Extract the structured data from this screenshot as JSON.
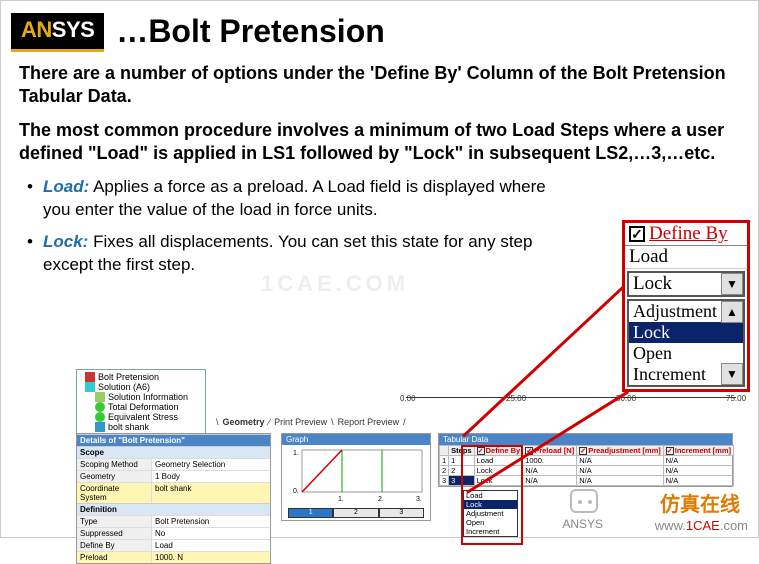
{
  "logo": {
    "prefix": "AN",
    "suffix": "SYS"
  },
  "title": "…Bolt Pretension",
  "para1": "There are a number of options under the 'Define By' Column of the Bolt Pretension Tabular Data.",
  "para2": "The most common procedure involves a minimum of two Load Steps where a user defined \"Load\" is applied in LS1 followed by \"Lock\" in subsequent LS2,…3,…etc.",
  "bullets": [
    {
      "kw": "Load:",
      "text": " Applies a force as a preload.   A Load field is displayed where you enter the value of the load in force units."
    },
    {
      "kw": "Lock:",
      "text": " Fixes all displacements. You can set this state for any step except the first step."
    }
  ],
  "zoom": {
    "header": "Define By",
    "row_load": "Load",
    "combo_value": "Lock",
    "options": [
      "Adjustment",
      "Lock",
      "Open",
      "Increment"
    ],
    "selected_index": 1
  },
  "tree": {
    "items": [
      "Bolt Pretension",
      "Solution (A6)",
      "Solution Information",
      "Total Deformation",
      "Equivalent Stress",
      "bolt shank"
    ]
  },
  "ruler": {
    "ticks": [
      "0.00",
      "25.00",
      "50.00",
      "75.00"
    ]
  },
  "bottom_tabs": {
    "items": [
      "Geometry",
      "Print Preview",
      "Report Preview"
    ],
    "active": 0
  },
  "details": {
    "title": "Details of \"Bolt Pretension\"",
    "groups": [
      {
        "header": "Scope",
        "rows": [
          {
            "label": "Scoping Method",
            "value": "Geometry Selection"
          },
          {
            "label": "Geometry",
            "value": "1 Body"
          },
          {
            "label": "Coordinate System",
            "value": "bolt shank",
            "yellow": true
          }
        ]
      },
      {
        "header": "Definition",
        "rows": [
          {
            "label": "Type",
            "value": "Bolt Pretension"
          },
          {
            "label": "Suppressed",
            "value": "No"
          },
          {
            "label": "Define By",
            "value": "Load"
          },
          {
            "label": "Preload",
            "value": "1000. N",
            "yellow": true
          }
        ]
      }
    ]
  },
  "graph": {
    "title": "Graph",
    "xticks": [
      "1.",
      "2.",
      "3."
    ],
    "yticks": [
      "0.",
      "1."
    ],
    "steps": [
      "1",
      "2",
      "3"
    ],
    "active_step": 0
  },
  "tabular": {
    "title": "Tabular Data",
    "columns": [
      "Steps",
      "Define By",
      "Preload [N]",
      "Preadjustment [mm]",
      "Increment [mm]"
    ],
    "rows": [
      {
        "step": "1",
        "define": "Load",
        "preload": "1000.",
        "preadj": "N/A",
        "incr": "N/A"
      },
      {
        "step": "2",
        "define": "Lock",
        "preload": "N/A",
        "preadj": "N/A",
        "incr": "N/A"
      },
      {
        "step": "3",
        "define": "Lock",
        "preload": "N/A",
        "preadj": "N/A",
        "incr": "N/A"
      }
    ],
    "dropdown_options": [
      "Load",
      "Lock",
      "Adjustment",
      "Open",
      "Increment"
    ],
    "dropdown_selected": 1
  },
  "watermarks": {
    "center": "1CAE.COM",
    "brand": "仿真在线",
    "site_prefix": "www.",
    "site_main": "1CAE",
    "site_suffix": ".com",
    "chat_label": "ANSYS"
  }
}
